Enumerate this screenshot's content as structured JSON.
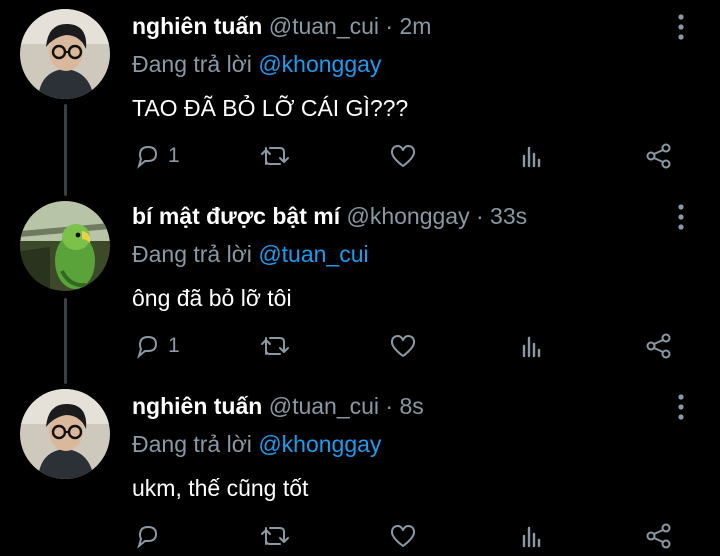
{
  "tweets": [
    {
      "name": "nghiên tuấn",
      "handle": "@tuan_cui",
      "separator": "·",
      "time": "2m",
      "reply_prefix": "Đang trả lời",
      "reply_to": "@khonggay",
      "text": "TAO ĐÃ BỎ LỠ CÁI GÌ???",
      "reply_count": "1",
      "avatar": "person-glasses-avatar"
    },
    {
      "name": "bí mật được bật mí",
      "handle": "@khonggay",
      "separator": "·",
      "time": "33s",
      "reply_prefix": "Đang trả lời",
      "reply_to": "@tuan_cui",
      "text": "ông đã bỏ lỡ tôi",
      "reply_count": "1",
      "avatar": "green-parrot-avatar"
    },
    {
      "name": "nghiên tuấn",
      "handle": "@tuan_cui",
      "separator": "·",
      "time": "8s",
      "reply_prefix": "Đang trả lời",
      "reply_to": "@khonggay",
      "text": "ukm, thế cũng tốt",
      "reply_count": "",
      "avatar": "person-glasses-avatar"
    }
  ],
  "icons": [
    "reply-icon",
    "retweet-icon",
    "like-icon",
    "analytics-icon",
    "share-icon",
    "more-icon"
  ],
  "colors": {
    "background": "#000000",
    "muted": "#8b98a5",
    "mention": "#1d9bf0",
    "thread_line": "#3a3f44"
  }
}
